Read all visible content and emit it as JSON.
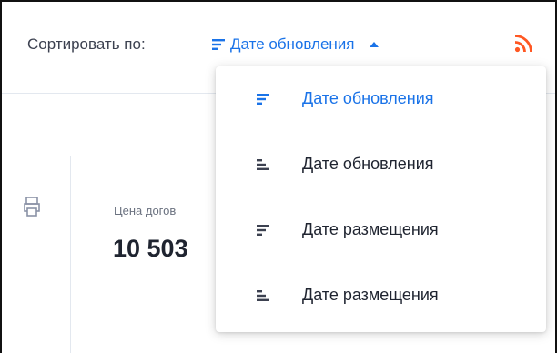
{
  "sort": {
    "label": "Сортировать по:",
    "current": "Дате обновления",
    "accent": "#1a73e8",
    "rss_color": "#ff5722"
  },
  "price": {
    "label": "Цена догов",
    "value": "10 503"
  },
  "dropdown": {
    "items": [
      {
        "label": "Дате обновления",
        "icon": "sort-desc-icon",
        "active": true
      },
      {
        "label": "Дате обновления",
        "icon": "sort-asc-icon",
        "active": false
      },
      {
        "label": "Дате размещения",
        "icon": "sort-desc-icon",
        "active": false
      },
      {
        "label": "Дате размещения",
        "icon": "sort-asc-icon",
        "active": false
      }
    ]
  }
}
